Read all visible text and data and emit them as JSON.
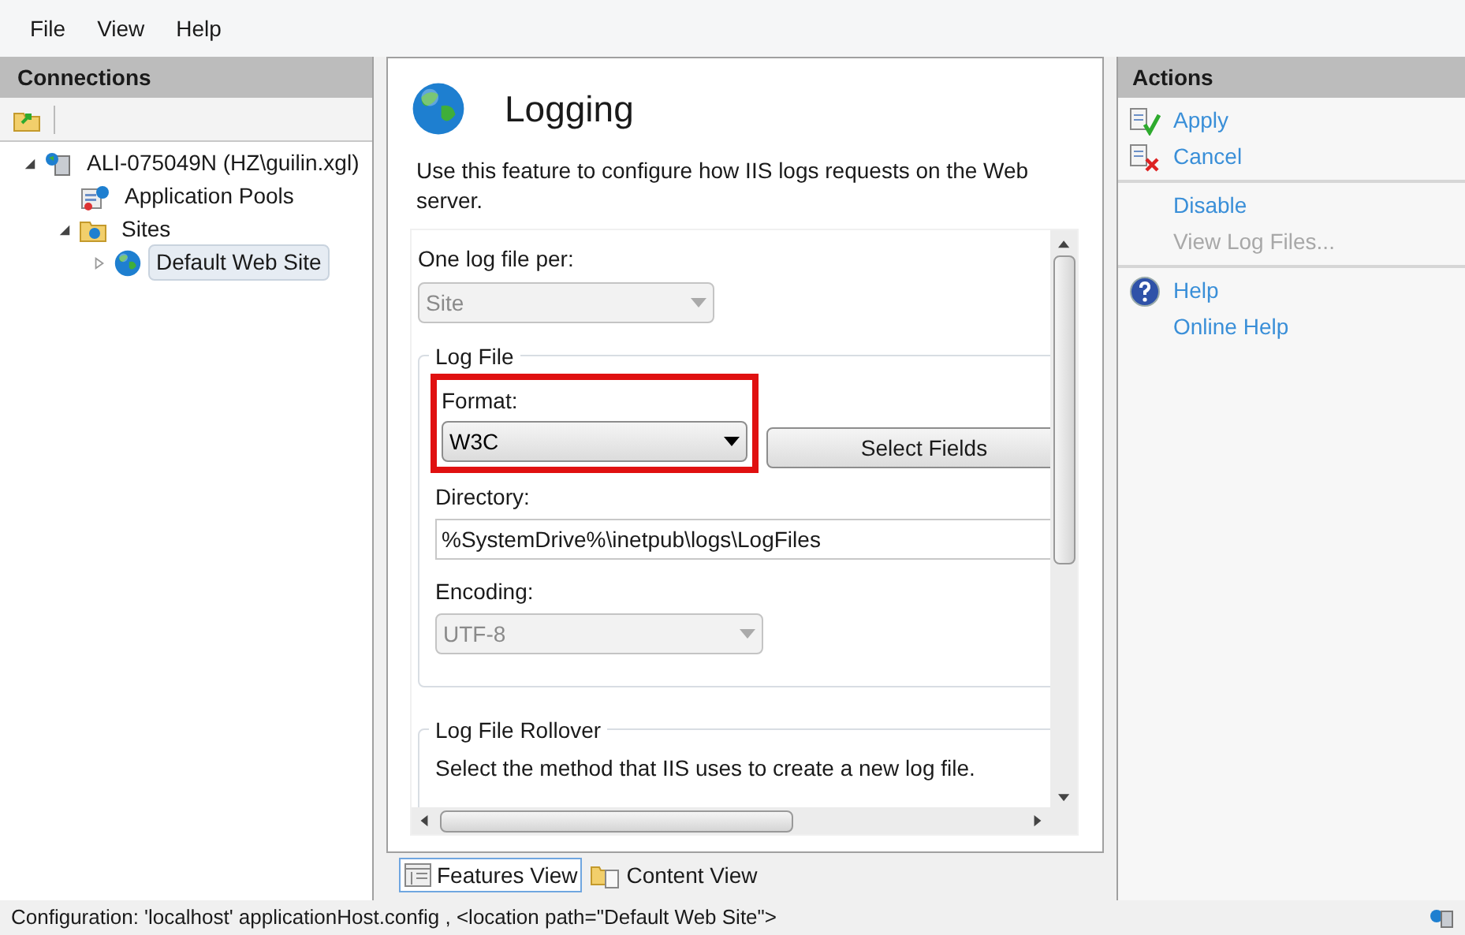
{
  "menu": [
    "File",
    "View",
    "Help"
  ],
  "connections": {
    "title": "Connections",
    "tree": [
      {
        "label": "ALI-075049N (HZ\\guilin.xgl)",
        "kind": "server",
        "expanded": true,
        "selected": false,
        "children": [
          {
            "label": "Application Pools",
            "kind": "pools",
            "selected": false
          },
          {
            "label": "Sites",
            "kind": "sites",
            "expanded": true,
            "selected": false,
            "children": [
              {
                "label": "Default Web Site",
                "kind": "site",
                "expanded": false,
                "selected": true
              }
            ]
          }
        ]
      }
    ]
  },
  "feature": {
    "title": "Logging",
    "description": "Use this feature to configure how IIS logs requests on the Web server.",
    "log_file_per": {
      "label": "One log file per:",
      "value": "Site",
      "disabled": true
    },
    "log_file": {
      "legend": "Log File",
      "format": {
        "label": "Format:",
        "value": "W3C",
        "disabled": false,
        "highlighted": true
      },
      "select_fields": "Select Fields",
      "directory": {
        "label": "Directory:",
        "value": "%SystemDrive%\\inetpub\\logs\\LogFiles"
      },
      "encoding": {
        "label": "Encoding:",
        "value": "UTF-8",
        "disabled": true
      }
    },
    "rollover": {
      "legend": "Log File Rollover",
      "description": "Select the method that IIS uses to create a new log file."
    }
  },
  "views": [
    {
      "label": "Features View",
      "kind": "features",
      "selected": true
    },
    {
      "label": "Content View",
      "kind": "content",
      "selected": false
    }
  ],
  "actions": {
    "title": "Actions",
    "groups": [
      [
        {
          "label": "Apply",
          "kind": "apply",
          "disabled": false
        },
        {
          "label": "Cancel",
          "kind": "cancel",
          "disabled": false
        }
      ],
      [
        {
          "label": "Disable",
          "kind": "none",
          "disabled": false
        },
        {
          "label": "View Log Files...",
          "kind": "none",
          "disabled": true
        }
      ],
      [
        {
          "label": "Help",
          "kind": "help",
          "disabled": false
        },
        {
          "label": "Online Help",
          "kind": "none",
          "disabled": false
        }
      ]
    ]
  },
  "status_bar": "Configuration: 'localhost' applicationHost.config , <location path=\"Default Web Site\">"
}
